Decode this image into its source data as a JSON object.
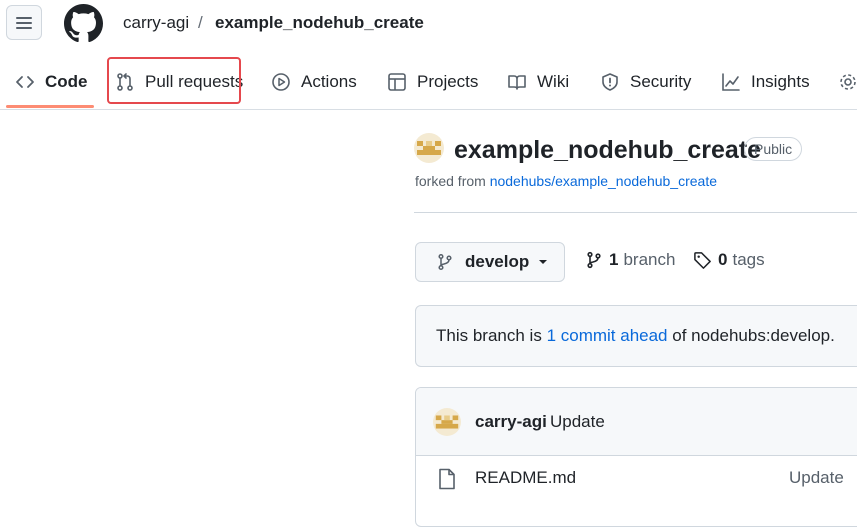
{
  "header": {
    "owner": "carry-agi",
    "separator": "/",
    "repo": "example_nodehub_create"
  },
  "tabs": [
    {
      "label": "Code",
      "icon": "code-icon"
    },
    {
      "label": "Pull requests",
      "icon": "git-pull-request-icon"
    },
    {
      "label": "Actions",
      "icon": "play-icon"
    },
    {
      "label": "Projects",
      "icon": "table-icon"
    },
    {
      "label": "Wiki",
      "icon": "book-icon"
    },
    {
      "label": "Security",
      "icon": "shield-icon"
    },
    {
      "label": "Insights",
      "icon": "graph-icon"
    }
  ],
  "repo_header": {
    "title": "example_nodehub_create",
    "visibility": "Public",
    "forked_prefix": "forked from",
    "forked_link": "nodehubs/example_nodehub_create"
  },
  "branch_bar": {
    "current_branch": "develop",
    "branch_count": "1",
    "branch_label": "branch",
    "tag_count": "0",
    "tag_label": "tags"
  },
  "ahead": {
    "prefix": "This branch is",
    "link": "1 commit ahead",
    "suffix": "of nodehubs:develop."
  },
  "commit": {
    "user": "carry-agi",
    "message": "Update"
  },
  "files": [
    {
      "name": "README.md",
      "message": "Update"
    }
  ],
  "colors": {
    "accent_underline": "#fd8c73",
    "link": "#0969da",
    "highlight_box": "#e5484d"
  }
}
